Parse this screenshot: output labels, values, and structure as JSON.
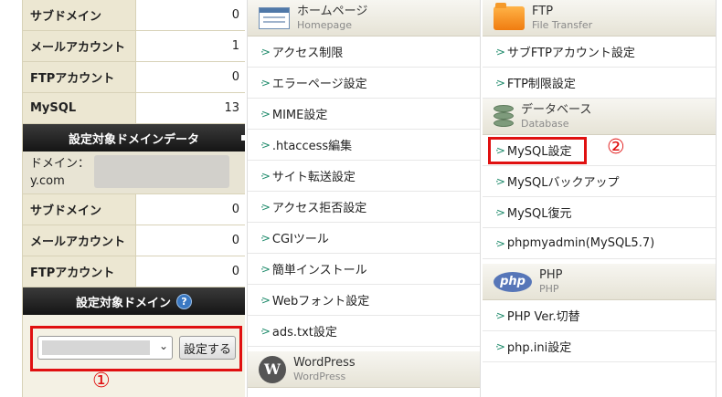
{
  "left": {
    "stats_top": [
      {
        "label": "サブドメイン",
        "value": "0"
      },
      {
        "label": "メールアカウント",
        "value": "1"
      },
      {
        "label": "FTPアカウント",
        "value": "0"
      },
      {
        "label": "MySQL",
        "value": "13"
      }
    ],
    "domain_header": "設定対象ドメインデータ",
    "domain_label": "ドメイン：",
    "domain_suffix": "y.com",
    "stats_bottom": [
      {
        "label": "サブドメイン",
        "value": "0"
      },
      {
        "label": "メールアカウント",
        "value": "0"
      },
      {
        "label": "FTPアカウント",
        "value": "0"
      }
    ],
    "select_header": "設定対象ドメイン",
    "help_icon": "?",
    "set_button": "設定する",
    "marker": "①"
  },
  "homepage": {
    "title": "ホームページ",
    "subtitle": "Homepage",
    "items": [
      "アクセス制限",
      "エラーページ設定",
      "MIME設定",
      ".htaccess編集",
      "サイト転送設定",
      "アクセス拒否設定",
      "CGIツール",
      "簡単インストール",
      "Webフォント設定",
      "ads.txt設定"
    ]
  },
  "wordpress": {
    "title": "WordPress",
    "subtitle": "WordPress",
    "icon": "W"
  },
  "ftp": {
    "title": "FTP",
    "subtitle": "File Transfer",
    "items": [
      "サブFTPアカウント設定",
      "FTP制限設定"
    ]
  },
  "database": {
    "title": "データベース",
    "subtitle": "Database",
    "items": [
      "MySQL設定",
      "MySQLバックアップ",
      "MySQL復元",
      "phpmyadmin(MySQL5.7)"
    ],
    "marker": "②"
  },
  "php": {
    "title": "PHP",
    "subtitle": "PHP",
    "icon": "php",
    "items": [
      "PHP Ver.切替",
      "php.ini設定"
    ]
  },
  "arrow_glyph": "·>"
}
